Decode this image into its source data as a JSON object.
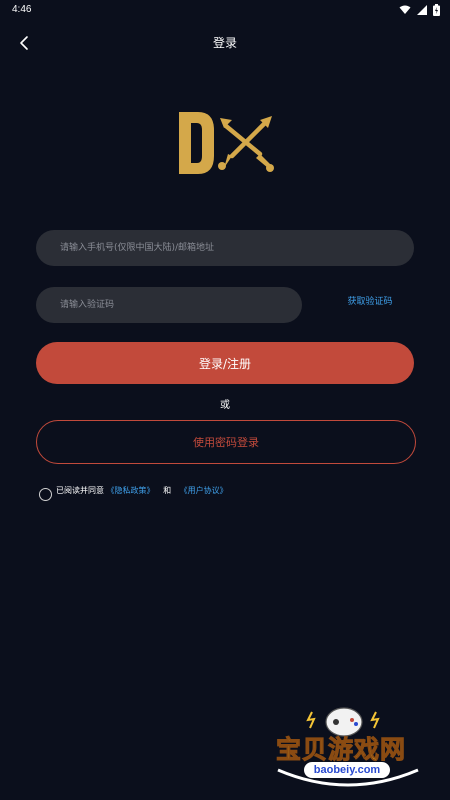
{
  "status_bar": {
    "time": "4:46"
  },
  "header": {
    "title": "登录"
  },
  "form": {
    "phone_placeholder": "请输入手机号(仅限中国大陆)/邮箱地址",
    "code_placeholder": "请输入验证码",
    "get_code_label": "获取验证码",
    "submit_label": "登录/注册",
    "or_label": "或",
    "password_login_label": "使用密码登录"
  },
  "agreement": {
    "prefix": "已阅读并同意",
    "privacy_link": "《隐私政策》",
    "and": "和",
    "user_link": "《用户协议》"
  },
  "watermark": {
    "brand": "宝贝游戏网",
    "url": "baobeiy.com"
  },
  "colors": {
    "background": "#0b0f1c",
    "accent": "#c24a3b",
    "link": "#3fa0ea",
    "logo_gold": "#d4a84a"
  }
}
